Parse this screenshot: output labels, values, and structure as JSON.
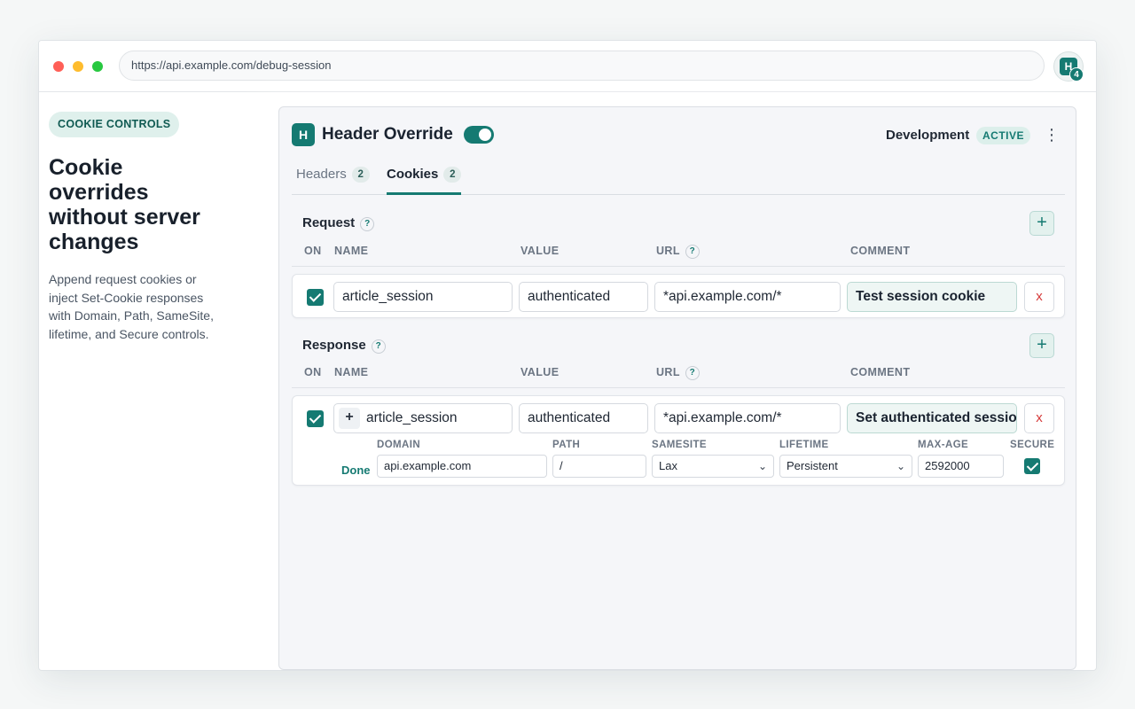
{
  "browser": {
    "url": "https://api.example.com/debug-session",
    "extension_logo": "H",
    "extension_badge": "4"
  },
  "intro": {
    "pill": "COOKIE CONTROLS",
    "title": "Cookie overrides without server changes",
    "description": "Append request cookies or inject Set-Cookie responses with Domain, Path, SameSite, lifetime, and Secure controls."
  },
  "app": {
    "logo": "H",
    "title": "Header Override",
    "enabled": true,
    "environment": "Development",
    "environment_status": "ACTIVE",
    "more_icon": "kebab-icon"
  },
  "tabs": [
    {
      "label": "Headers",
      "count": "2",
      "active": false
    },
    {
      "label": "Cookies",
      "count": "2",
      "active": true
    }
  ],
  "columns": {
    "on": "ON",
    "name": "NAME",
    "value": "VALUE",
    "url": "URL",
    "comment": "COMMENT",
    "help": "?"
  },
  "request": {
    "title": "Request",
    "add_label": "+",
    "rows": [
      {
        "enabled": true,
        "name": "article_session",
        "value": "authenticated",
        "url": "*api.example.com/*",
        "comment": "Test session cookie",
        "delete_label": "x"
      }
    ]
  },
  "response": {
    "title": "Response",
    "add_label": "+",
    "rows": [
      {
        "enabled": true,
        "expand_label": "+",
        "name": "article_session",
        "value": "authenticated",
        "url": "*api.example.com/*",
        "comment": "Set authenticated session",
        "delete_label": "x",
        "details": {
          "done_label": "Done",
          "domain_label": "DOMAIN",
          "domain": "api.example.com",
          "path_label": "PATH",
          "path": "/",
          "samesite_label": "SAMESITE",
          "samesite": "Lax",
          "lifetime_label": "LIFETIME",
          "lifetime": "Persistent",
          "maxage_label": "MAX-AGE",
          "maxage": "2592000",
          "secure_label": "SECURE",
          "secure": true
        }
      }
    ]
  },
  "colors": {
    "accent": "#157a72",
    "accent_light": "#dcefeb",
    "danger": "#d63a3a"
  }
}
